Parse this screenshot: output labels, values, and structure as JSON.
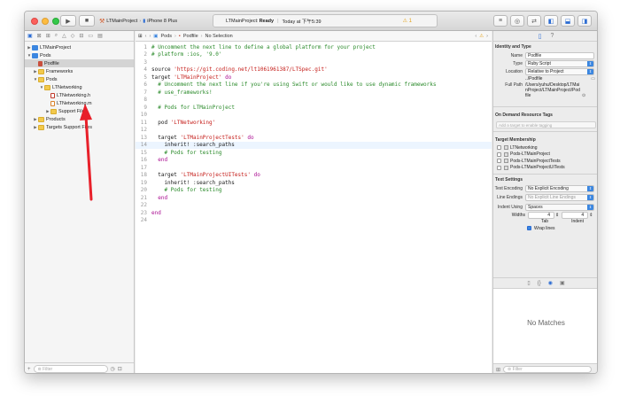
{
  "toolbar": {
    "scheme_project": "LTMainProject",
    "scheme_device": "iPhone 8 Plus",
    "activity_project": "LTMainProject:",
    "activity_status": "Ready",
    "activity_time": "Today at 下午5:39",
    "warning_count": "1"
  },
  "navigator": {
    "items": [
      {
        "label": "LTMainProject",
        "indent": 0,
        "icon": "proj",
        "tri": "▶"
      },
      {
        "label": "Pods",
        "indent": 0,
        "icon": "proj",
        "tri": "▼"
      },
      {
        "label": "Podfile",
        "indent": 1,
        "icon": "pod",
        "tri": "",
        "selected": true
      },
      {
        "label": "Frameworks",
        "indent": 1,
        "icon": "folder",
        "tri": "▶"
      },
      {
        "label": "Pods",
        "indent": 1,
        "icon": "folder",
        "tri": "▼"
      },
      {
        "label": "LTNetworking",
        "indent": 2,
        "icon": "folder",
        "tri": "▼"
      },
      {
        "label": "LTNetworking.h",
        "indent": 3,
        "icon": "hfile",
        "tri": ""
      },
      {
        "label": "LTNetworking.m",
        "indent": 3,
        "icon": "mfile",
        "tri": ""
      },
      {
        "label": "Support Files",
        "indent": 3,
        "icon": "folder",
        "tri": "▶"
      },
      {
        "label": "Products",
        "indent": 1,
        "icon": "folder",
        "tri": "▶"
      },
      {
        "label": "Targets Support Files",
        "indent": 1,
        "icon": "folder",
        "tri": "▶"
      }
    ],
    "filter_placeholder": "Filter"
  },
  "jumpbar": {
    "crumb_pods": "Pods",
    "crumb_podfile": "Podfile",
    "crumb_selection": "No Selection"
  },
  "code": {
    "current_line": 14,
    "lines": [
      [
        [
          "c-com",
          "# Uncomment the next line to define a global platform for your project"
        ]
      ],
      [
        [
          "c-com",
          "# platform :ios, '9.0'"
        ]
      ],
      [],
      [
        [
          "c-plain",
          "source "
        ],
        [
          "c-str",
          "'https://git.coding.net/lt1061961387/LTSpec.git'"
        ]
      ],
      [
        [
          "c-plain",
          "target "
        ],
        [
          "c-str",
          "'LTMainProject'"
        ],
        [
          "c-plain",
          " "
        ],
        [
          "c-kw",
          "do"
        ]
      ],
      [
        [
          "c-plain",
          "  "
        ],
        [
          "c-com",
          "# Uncomment the next line if you're using Swift or would like to use dynamic frameworks"
        ]
      ],
      [
        [
          "c-plain",
          "  "
        ],
        [
          "c-com",
          "# use_frameworks!"
        ]
      ],
      [],
      [
        [
          "c-plain",
          "  "
        ],
        [
          "c-com",
          "# Pods for LTMainProject"
        ]
      ],
      [],
      [
        [
          "c-plain",
          "  pod "
        ],
        [
          "c-str",
          "'LTNetworking'"
        ]
      ],
      [],
      [
        [
          "c-plain",
          "  target "
        ],
        [
          "c-str",
          "'LTMainProjectTests'"
        ],
        [
          "c-plain",
          " "
        ],
        [
          "c-kw",
          "do"
        ]
      ],
      [
        [
          "c-plain",
          "    inherit! :search_paths"
        ]
      ],
      [
        [
          "c-plain",
          "    "
        ],
        [
          "c-com",
          "# Pods for testing"
        ]
      ],
      [
        [
          "c-plain",
          "  "
        ],
        [
          "c-kw",
          "end"
        ]
      ],
      [],
      [
        [
          "c-plain",
          "  target "
        ],
        [
          "c-str",
          "'LTMainProjectUITests'"
        ],
        [
          "c-plain",
          " "
        ],
        [
          "c-kw",
          "do"
        ]
      ],
      [
        [
          "c-plain",
          "    inherit! :search_paths"
        ]
      ],
      [
        [
          "c-plain",
          "    "
        ],
        [
          "c-com",
          "# Pods for testing"
        ]
      ],
      [
        [
          "c-plain",
          "  "
        ],
        [
          "c-kw",
          "end"
        ]
      ],
      [],
      [
        [
          "c-kw",
          "end"
        ]
      ],
      []
    ]
  },
  "inspector": {
    "identity_title": "Identity and Type",
    "name_label": "Name",
    "name_value": "Podfile",
    "type_label": "Type",
    "type_value": "Ruby Script",
    "location_label": "Location",
    "location_value": "Relative to Project",
    "location_path": "../Podfile",
    "fullpath_label": "Full Path",
    "fullpath_value": "/Users/yuhu/Desktop/LTMainProject/LTMainProject/Podfile",
    "odr_title": "On Demand Resource Tags",
    "odr_placeholder": "Add a target to enable tagging",
    "membership_title": "Target Membership",
    "targets": [
      {
        "label": "LTNetworking",
        "app": false
      },
      {
        "label": "Pods-LTMainProject",
        "app": false
      },
      {
        "label": "Pods-LTMainProjectTests",
        "app": false
      },
      {
        "label": "Pods-LTMainProjectUITests",
        "app": false
      }
    ],
    "text_title": "Text Settings",
    "encoding_label": "Text Encoding",
    "encoding_value": "No Explicit Encoding",
    "endings_label": "Line Endings",
    "endings_value": "No Explicit Line Endings",
    "indent_label": "Indent Using",
    "indent_value": "Spaces",
    "widths_label": "Widths",
    "tab_width": "4",
    "indent_width": "4",
    "tab_label": "Tab",
    "indent_caption": "Indent",
    "wrap_label": "Wrap lines",
    "no_matches": "No Matches",
    "filter_placeholder": "Filter"
  },
  "colors": {
    "accent": "#2a6bd3",
    "arrow": "#e8202a"
  }
}
